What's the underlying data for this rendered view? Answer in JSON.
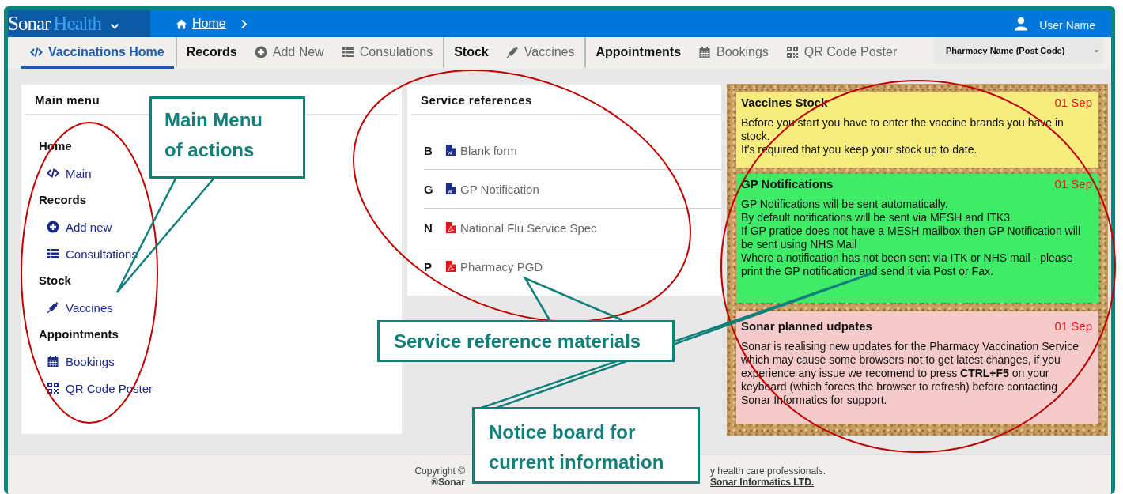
{
  "header": {
    "logo": {
      "part_1": "Sonar",
      "part_2": "Health"
    },
    "breadcrumb": "Home",
    "user": "User Name"
  },
  "nav": {
    "items": [
      {
        "label": "Vaccinations Home",
        "kind": "home",
        "selected": true
      },
      {
        "label": "Records",
        "kind": "heading",
        "selected": false
      },
      {
        "label": "Add New",
        "kind": "link",
        "selected": false
      },
      {
        "label": "Consulations",
        "kind": "link",
        "selected": false
      },
      {
        "label": "Stock",
        "kind": "heading",
        "selected": false
      },
      {
        "label": "Vaccines",
        "kind": "link",
        "selected": false
      },
      {
        "label": "Appointments",
        "kind": "heading",
        "selected": false
      },
      {
        "label": "Bookings",
        "kind": "link",
        "selected": false
      },
      {
        "label": "QR Code Poster",
        "kind": "link",
        "selected": false
      }
    ],
    "pharmacy": "Pharmacy Name (Post Code)"
  },
  "main_menu": {
    "title": "Main menu",
    "sections": [
      {
        "label": "Home",
        "children": [
          {
            "label": "Main"
          }
        ]
      },
      {
        "label": "Records",
        "children": [
          {
            "label": "Add new"
          },
          {
            "label": "Consultations"
          }
        ]
      },
      {
        "label": "Stock",
        "children": [
          {
            "label": "Vaccines"
          }
        ]
      },
      {
        "label": "Appointments",
        "children": [
          {
            "label": "Bookings"
          },
          {
            "label": "QR Code Poster"
          }
        ]
      }
    ]
  },
  "service_references": {
    "title": "Service references",
    "items": [
      {
        "letter": "B",
        "label": "Blank form",
        "kind": "word"
      },
      {
        "letter": "G",
        "label": "GP Notification",
        "kind": "word"
      },
      {
        "letter": "N",
        "label": "National Flu Service Spec",
        "kind": "pdf"
      },
      {
        "letter": "P",
        "label": "Pharmacy PGD",
        "kind": "pdf"
      }
    ]
  },
  "notices": [
    {
      "title": "Vaccines Stock",
      "date": "01 Sep",
      "color": "#f7ed7e",
      "paragraphs": [
        "Before you start you have to enter the vaccine brands you have in stock.",
        "It's required that you keep your stock up to date."
      ]
    },
    {
      "title": "GP Notifications",
      "date": "01 Sep",
      "color": "#3feb67",
      "paragraphs": [
        "GP Notifications will be sent automatically.",
        "By default notifications will be sent via MESH and ITK3.",
        "If GP pratice does not have a MESH mailbox then GP Notification will be sent using NHS Mail",
        "Where a notification has not been sent via ITK or NHS mail - please print the GP notification and send it via Post or Fax."
      ]
    },
    {
      "title": "Sonar planned udpates",
      "date": "01 Sep",
      "color": "#f5caca",
      "paragraphs": [
        "Sonar is realising new updates for the Pharmacy Vaccination Service which may cause some browsers not to get latest changes, if you experience any issue we recomend to press **CTRL+F5** on your keyboard (which forces the browser to refresh) before contacting Sonar Informatics for support."
      ]
    }
  ],
  "footer": {
    "line_1": {
      "start": "Copyright ©",
      "end": "y health care professionals."
    },
    "line_2": {
      "start": "®Sonar",
      "link": "Sonar Informatics LTD."
    }
  },
  "annotations": [
    {
      "lines": [
        "Main Menu",
        "of actions"
      ]
    },
    {
      "lines": [
        "Service reference materials"
      ]
    },
    {
      "lines": [
        "Notice board for",
        "current information"
      ]
    }
  ]
}
